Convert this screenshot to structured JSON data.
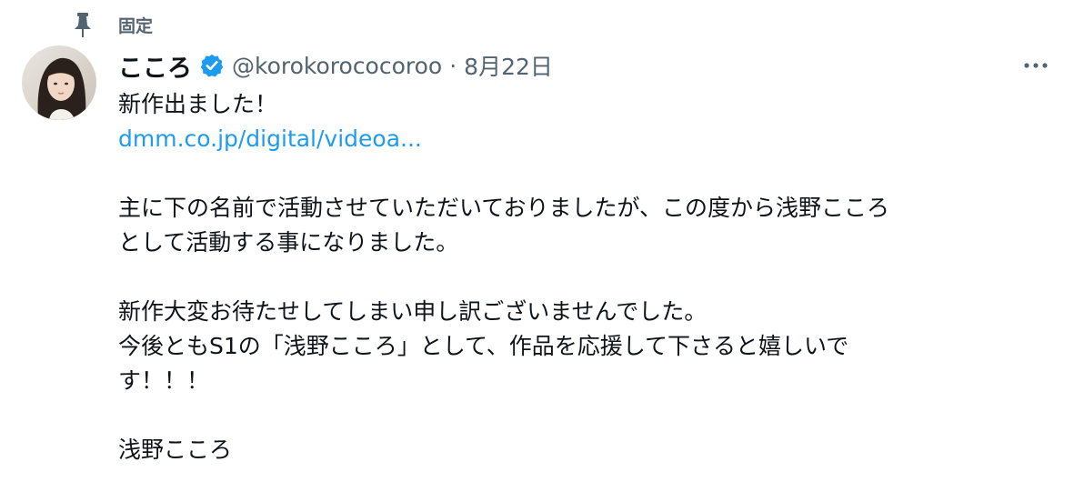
{
  "pinned": {
    "label": "固定",
    "icon": "pin-icon"
  },
  "author": {
    "display_name": "こころ",
    "verified": true,
    "verified_icon": "verified-badge-icon",
    "handle": "@korokorococoroo",
    "separator": "·",
    "date": "8月22日"
  },
  "more": {
    "icon": "more-horizontal-icon"
  },
  "body": {
    "line1": "新作出ました！",
    "link": "dmm.co.jp/digital/videoa...",
    "line3": " 主に下の名前で活動させていただいておりましたが、この度から浅野こころ",
    "line4": "として活動する事になりました。",
    "line5": "新作大変お待たせしてしまい申し訳ございませんでした。",
    "line6": "今後ともS1の「浅野こころ」として、作品を応援して下さると嬉しいで",
    "line7": "す！！！",
    "line8": "浅野こころ"
  },
  "colors": {
    "text": "#0f1419",
    "secondary": "#536471",
    "accent": "#1d9bf0"
  }
}
